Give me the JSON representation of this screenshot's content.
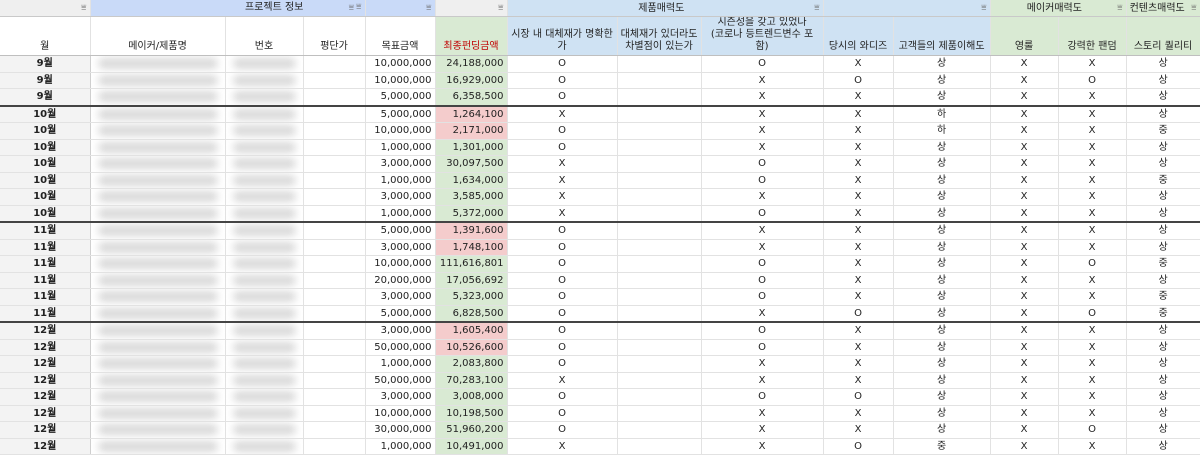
{
  "headers_top": {
    "project": "프로젝트 정보",
    "product": "제품매력도",
    "maker": "메이커매력도",
    "content": "컨텐츠매력도"
  },
  "filter_icon": "filter-icon",
  "headers": {
    "month": "월",
    "maker": "메이커/제품명",
    "number": "번호",
    "review": "평단가",
    "target": "목표금액",
    "funding": "최종펀딩금액",
    "alt_clear": "시장 내 대체재가 명확한가",
    "diff_1": "대체재가 있더라도",
    "diff_2": "차별점이 있는가",
    "season_1": "시즌성을 갖고 있었나",
    "season_2": "(코로나 등트렌드변수 포함)",
    "wants": "당시의 와디즈",
    "understand": "고객들의 제품이해도",
    "young": "영룰",
    "brand": "강력한 팬덤",
    "story": "스토리 퀄리티"
  },
  "colors": {
    "funding_green": "#d9ead3",
    "funding_red": "#f4cccc",
    "header_blue": "#c9daf8",
    "header_lightblue": "#cfe2f3",
    "header_green": "#d9ead3"
  },
  "rows": [
    {
      "month": "9월",
      "target": "10,000,000",
      "funding": "24,188,000",
      "fc": "g",
      "a": "O",
      "b": "",
      "c": "O",
      "d": "X",
      "e": "상",
      "f": "X",
      "g": "X",
      "h": "상"
    },
    {
      "month": "9월",
      "target": "10,000,000",
      "funding": "16,929,000",
      "fc": "g",
      "a": "O",
      "b": "",
      "c": "X",
      "d": "O",
      "e": "상",
      "f": "X",
      "g": "O",
      "h": "상"
    },
    {
      "month": "9월",
      "target": "5,000,000",
      "funding": "6,358,500",
      "fc": "g",
      "a": "O",
      "b": "",
      "c": "X",
      "d": "X",
      "e": "상",
      "f": "X",
      "g": "X",
      "h": "상"
    },
    {
      "month": "10월",
      "target": "5,000,000",
      "funding": "1,264,100",
      "fc": "r",
      "a": "X",
      "b": "",
      "c": "X",
      "d": "X",
      "e": "하",
      "f": "X",
      "g": "X",
      "h": "상"
    },
    {
      "month": "10월",
      "target": "10,000,000",
      "funding": "2,171,000",
      "fc": "r",
      "a": "O",
      "b": "",
      "c": "X",
      "d": "X",
      "e": "하",
      "f": "X",
      "g": "X",
      "h": "중"
    },
    {
      "month": "10월",
      "target": "1,000,000",
      "funding": "1,301,000",
      "fc": "g",
      "a": "O",
      "b": "",
      "c": "X",
      "d": "X",
      "e": "상",
      "f": "X",
      "g": "X",
      "h": "상"
    },
    {
      "month": "10월",
      "target": "3,000,000",
      "funding": "30,097,500",
      "fc": "g",
      "a": "X",
      "b": "",
      "c": "O",
      "d": "X",
      "e": "상",
      "f": "X",
      "g": "X",
      "h": "상"
    },
    {
      "month": "10월",
      "target": "1,000,000",
      "funding": "1,634,000",
      "fc": "g",
      "a": "X",
      "b": "",
      "c": "O",
      "d": "X",
      "e": "상",
      "f": "X",
      "g": "X",
      "h": "중"
    },
    {
      "month": "10월",
      "target": "3,000,000",
      "funding": "3,585,000",
      "fc": "g",
      "a": "X",
      "b": "",
      "c": "X",
      "d": "X",
      "e": "상",
      "f": "X",
      "g": "X",
      "h": "상"
    },
    {
      "month": "10월",
      "target": "1,000,000",
      "funding": "5,372,000",
      "fc": "g",
      "a": "X",
      "b": "",
      "c": "O",
      "d": "X",
      "e": "상",
      "f": "X",
      "g": "X",
      "h": "상"
    },
    {
      "month": "11월",
      "target": "5,000,000",
      "funding": "1,391,600",
      "fc": "r",
      "a": "O",
      "b": "",
      "c": "X",
      "d": "X",
      "e": "상",
      "f": "X",
      "g": "X",
      "h": "상"
    },
    {
      "month": "11월",
      "target": "3,000,000",
      "funding": "1,748,100",
      "fc": "r",
      "a": "O",
      "b": "",
      "c": "X",
      "d": "X",
      "e": "상",
      "f": "X",
      "g": "X",
      "h": "상"
    },
    {
      "month": "11월",
      "target": "10,000,000",
      "funding": "111,616,801",
      "fc": "g",
      "a": "O",
      "b": "",
      "c": "O",
      "d": "X",
      "e": "상",
      "f": "X",
      "g": "O",
      "h": "중"
    },
    {
      "month": "11월",
      "target": "20,000,000",
      "funding": "17,056,692",
      "fc": "g",
      "a": "O",
      "b": "",
      "c": "O",
      "d": "X",
      "e": "상",
      "f": "X",
      "g": "X",
      "h": "상"
    },
    {
      "month": "11월",
      "target": "3,000,000",
      "funding": "5,323,000",
      "fc": "g",
      "a": "O",
      "b": "",
      "c": "O",
      "d": "X",
      "e": "상",
      "f": "X",
      "g": "X",
      "h": "중"
    },
    {
      "month": "11월",
      "target": "5,000,000",
      "funding": "6,828,500",
      "fc": "g",
      "a": "O",
      "b": "",
      "c": "X",
      "d": "O",
      "e": "상",
      "f": "X",
      "g": "O",
      "h": "중"
    },
    {
      "month": "12월",
      "target": "3,000,000",
      "funding": "1,605,400",
      "fc": "r",
      "a": "O",
      "b": "",
      "c": "O",
      "d": "X",
      "e": "상",
      "f": "X",
      "g": "X",
      "h": "상"
    },
    {
      "month": "12월",
      "target": "50,000,000",
      "funding": "10,526,600",
      "fc": "r",
      "a": "O",
      "b": "",
      "c": "O",
      "d": "X",
      "e": "상",
      "f": "X",
      "g": "X",
      "h": "상"
    },
    {
      "month": "12월",
      "target": "1,000,000",
      "funding": "2,083,800",
      "fc": "g",
      "a": "O",
      "b": "",
      "c": "X",
      "d": "X",
      "e": "상",
      "f": "X",
      "g": "X",
      "h": "상"
    },
    {
      "month": "12월",
      "target": "50,000,000",
      "funding": "70,283,100",
      "fc": "g",
      "a": "X",
      "b": "",
      "c": "X",
      "d": "X",
      "e": "상",
      "f": "X",
      "g": "X",
      "h": "상"
    },
    {
      "month": "12월",
      "target": "3,000,000",
      "funding": "3,008,000",
      "fc": "g",
      "a": "O",
      "b": "",
      "c": "O",
      "d": "O",
      "e": "상",
      "f": "X",
      "g": "X",
      "h": "상"
    },
    {
      "month": "12월",
      "target": "10,000,000",
      "funding": "10,198,500",
      "fc": "g",
      "a": "O",
      "b": "",
      "c": "X",
      "d": "X",
      "e": "상",
      "f": "X",
      "g": "X",
      "h": "상"
    },
    {
      "month": "12월",
      "target": "30,000,000",
      "funding": "51,960,200",
      "fc": "g",
      "a": "O",
      "b": "",
      "c": "X",
      "d": "X",
      "e": "상",
      "f": "X",
      "g": "O",
      "h": "상"
    },
    {
      "month": "12월",
      "target": "1,000,000",
      "funding": "10,491,000",
      "fc": "g",
      "a": "X",
      "b": "",
      "c": "X",
      "d": "O",
      "e": "중",
      "f": "X",
      "g": "X",
      "h": "상"
    }
  ]
}
